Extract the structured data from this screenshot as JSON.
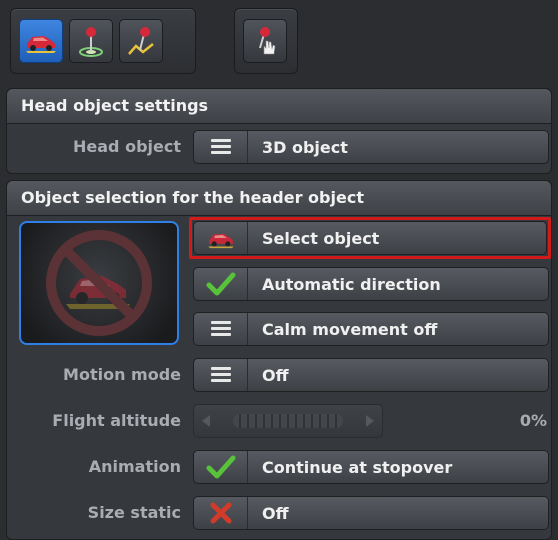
{
  "toolbar": {
    "group1": [
      {
        "icon": "car-object-icon",
        "active": true
      },
      {
        "icon": "pin-on-target-icon",
        "active": false
      },
      {
        "icon": "pin-on-path-icon",
        "active": false
      }
    ],
    "group2": [
      {
        "icon": "pin-hand-icon",
        "active": false
      }
    ]
  },
  "head_section": {
    "title": "Head object settings",
    "row": {
      "label": "Head object",
      "value": "3D object",
      "icon": "list-icon"
    }
  },
  "object_section": {
    "title": "Object selection for the header object",
    "preview": {
      "icon": "no-object-icon"
    },
    "select_button": {
      "label": "Select object",
      "icon": "car-object-icon"
    },
    "auto_direction": {
      "label": "Automatic direction",
      "icon": "checkmark-icon"
    },
    "calm_movement": {
      "label": "Calm movement off",
      "icon": "list-icon"
    },
    "motion_mode": {
      "label": "Motion mode",
      "value": "Off",
      "icon": "list-icon"
    },
    "flight_altitude": {
      "label": "Flight altitude",
      "percent": "0%",
      "level": 0
    },
    "animation": {
      "label": "Animation",
      "value": "Continue at stopover",
      "icon": "checkmark-icon"
    },
    "size_static": {
      "label": "Size static",
      "value": "Off",
      "icon": "cross-icon"
    }
  },
  "colors": {
    "accent_blue": "#2f7fe8",
    "highlight_red": "#d11a1a",
    "check_green": "#58c23a",
    "cross_red": "#d23a2a"
  }
}
